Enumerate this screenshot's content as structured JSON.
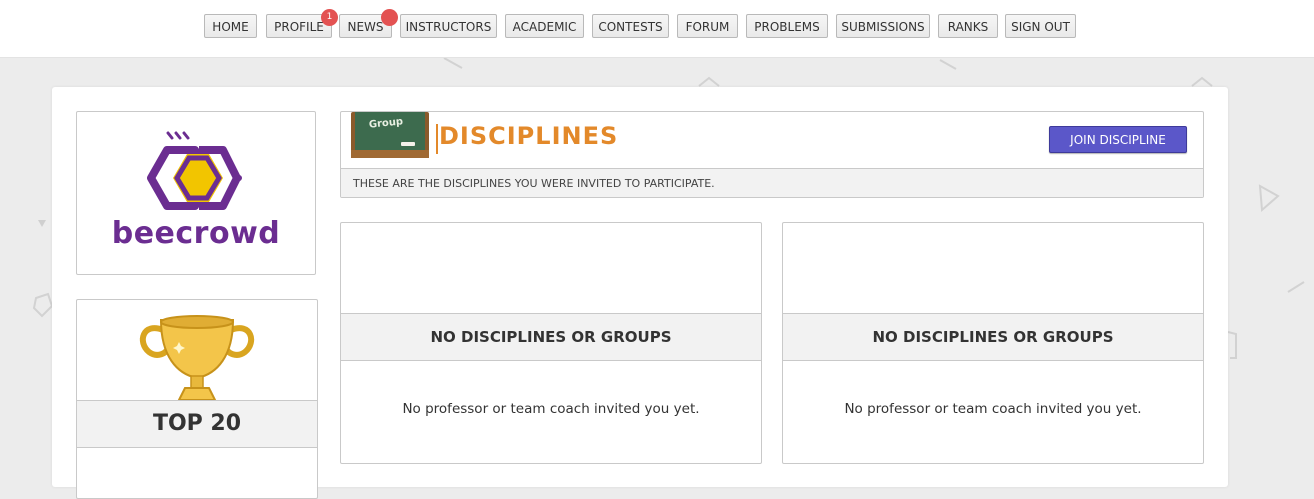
{
  "nav": {
    "items": [
      "HOME",
      "PROFILE",
      "NEWS",
      "INSTRUCTORS",
      "ACADEMIC",
      "CONTESTS",
      "FORUM",
      "PROBLEMS",
      "SUBMISSIONS",
      "RANKS",
      "SIGN OUT"
    ],
    "profile_badge": "1"
  },
  "logo": {
    "text": "beecrowd"
  },
  "top20": {
    "label": "TOP 20"
  },
  "header": {
    "chalkboard_text": "Group",
    "title": "DISCIPLINES",
    "join_button": "JOIN DISCIPLINE",
    "subtitle": "THESE ARE THE DISCIPLINES YOU WERE INVITED TO PARTICIPATE."
  },
  "panels": [
    {
      "title": "NO DISCIPLINES OR GROUPS",
      "message": "No professor or team coach invited you yet."
    },
    {
      "title": "NO DISCIPLINES OR GROUPS",
      "message": "No professor or team coach invited you yet."
    }
  ],
  "colors": {
    "brand_purple": "#6b2d91",
    "brand_yellow": "#f2c500",
    "title_orange": "#e3892a",
    "button_purple": "#5b57c9",
    "badge_red": "#e35252"
  }
}
